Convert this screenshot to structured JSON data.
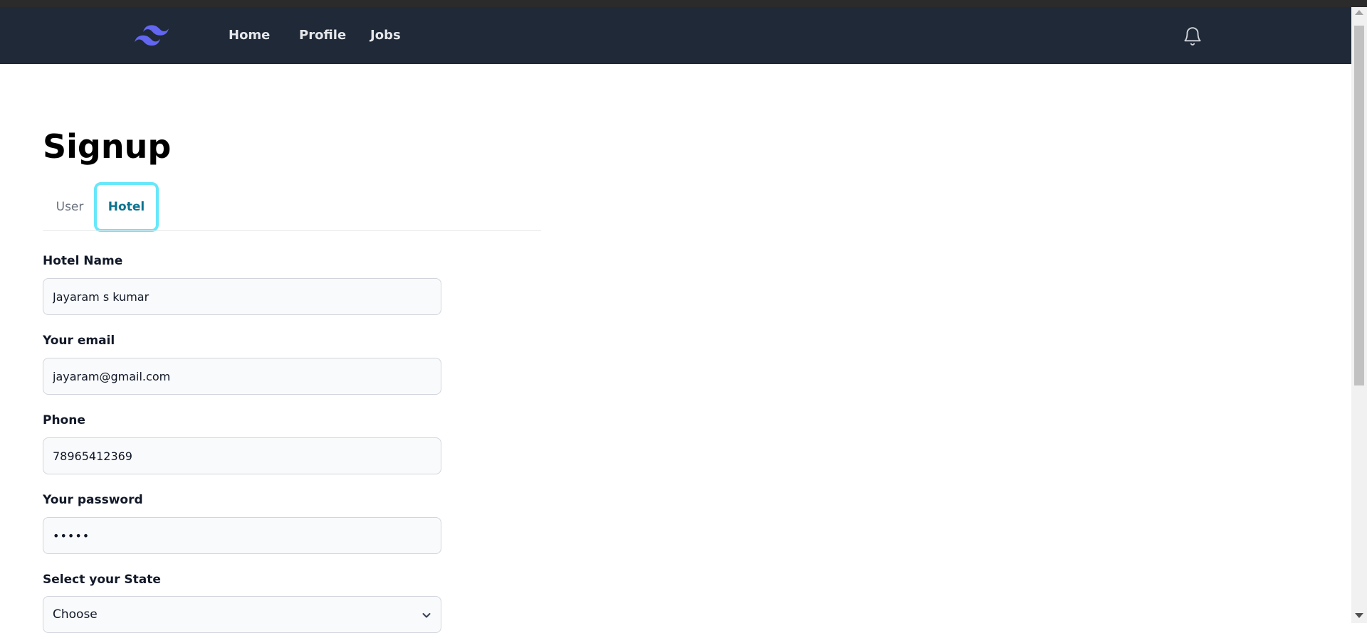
{
  "nav": {
    "links": [
      {
        "label": "Home"
      },
      {
        "label": "Profile"
      },
      {
        "label": "Jobs"
      }
    ]
  },
  "page": {
    "title": "Signup"
  },
  "tabs": [
    {
      "label": "User",
      "active": false
    },
    {
      "label": "Hotel",
      "active": true
    }
  ],
  "form": {
    "hotel_name": {
      "label": "Hotel Name",
      "value": "Jayaram s kumar"
    },
    "email": {
      "label": "Your email",
      "value": "jayaram@gmail.com"
    },
    "phone": {
      "label": "Phone",
      "value": "78965412369"
    },
    "password": {
      "label": "Your password",
      "value": "•••••"
    },
    "state": {
      "label": "Select your State",
      "selected": "Choose"
    }
  },
  "colors": {
    "navbar_bg": "#1f2937",
    "logo": "#6366f1",
    "active_tab_text": "#0e7490",
    "active_tab_ring": "#67e8f9"
  },
  "icons": {
    "logo": "tailwind-logo-icon",
    "notifications": "bell-icon",
    "select": "chevron-down-icon"
  }
}
